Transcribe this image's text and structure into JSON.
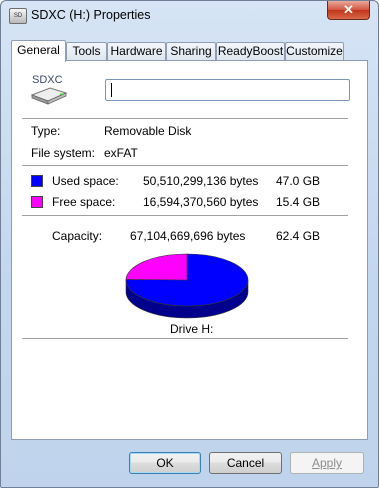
{
  "window": {
    "title": "SDXC (H:) Properties",
    "close_glyph": "✕",
    "icon": "sd-card-icon"
  },
  "tabs": [
    {
      "label": "General",
      "active": true
    },
    {
      "label": "Tools",
      "active": false
    },
    {
      "label": "Hardware",
      "active": false
    },
    {
      "label": "Sharing",
      "active": false
    },
    {
      "label": "ReadyBoost",
      "active": false
    },
    {
      "label": "Customize",
      "active": false
    }
  ],
  "general": {
    "icon_text": "SDXC",
    "name_value": "",
    "type_label": "Type:",
    "type_value": "Removable Disk",
    "fs_label": "File system:",
    "fs_value": "exFAT",
    "used": {
      "label": "Used space:",
      "bytes": "50,510,299,136 bytes",
      "size": "47.0 GB",
      "color": "#0000ff"
    },
    "free": {
      "label": "Free space:",
      "bytes": "16,594,370,560 bytes",
      "size": "15.4 GB",
      "color": "#ff00ff"
    },
    "capacity": {
      "label": "Capacity:",
      "bytes": "67,104,669,696 bytes",
      "size": "62.4 GB"
    },
    "drive_label": "Drive H:"
  },
  "chart_data": {
    "type": "pie",
    "categories": [
      "Used space",
      "Free space"
    ],
    "values": [
      47.0,
      15.4
    ],
    "colors": [
      "#0000ff",
      "#ff00ff"
    ],
    "title": "Drive H:"
  },
  "buttons": {
    "ok": "OK",
    "cancel": "Cancel",
    "apply": "Apply"
  }
}
